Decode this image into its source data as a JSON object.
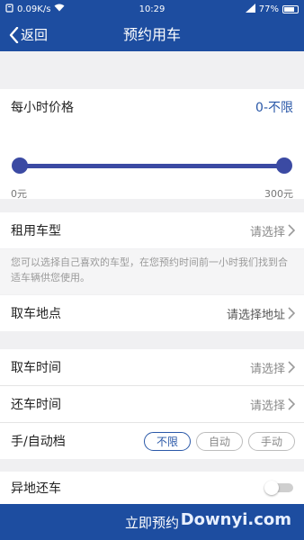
{
  "status_bar": {
    "net_speed": "0.09K/s",
    "time": "10:29",
    "battery": "77%",
    "battery_level": 0.77
  },
  "header": {
    "back_label": "返回",
    "title": "预约用车"
  },
  "price": {
    "label": "每小时价格",
    "range": "0-不限",
    "min_label": "0元",
    "max_label": "300元",
    "slider_low_fraction": 0,
    "slider_high_fraction": 1
  },
  "car_type": {
    "label": "租用车型",
    "value": "请选择",
    "hint": "您可以选择自己喜欢的车型，在您预约时间前一小时我们找到合适车辆供您使用。"
  },
  "pickup_location": {
    "label": "取车地点",
    "value": "请选择地址"
  },
  "pickup_time": {
    "label": "取车时间",
    "value": "请选择"
  },
  "return_time": {
    "label": "还车时间",
    "value": "请选择"
  },
  "transmission": {
    "label": "手/自动档",
    "options": [
      "不限",
      "自动",
      "手动"
    ],
    "selected": "不限"
  },
  "remote_return": {
    "label": "异地还车",
    "enabled": false
  },
  "submit_label": "立即预约",
  "watermark": "Downyi.com",
  "colors": {
    "primary": "#1d4da0",
    "slider": "#3b4aa3",
    "accent_text": "#2a58a8"
  }
}
